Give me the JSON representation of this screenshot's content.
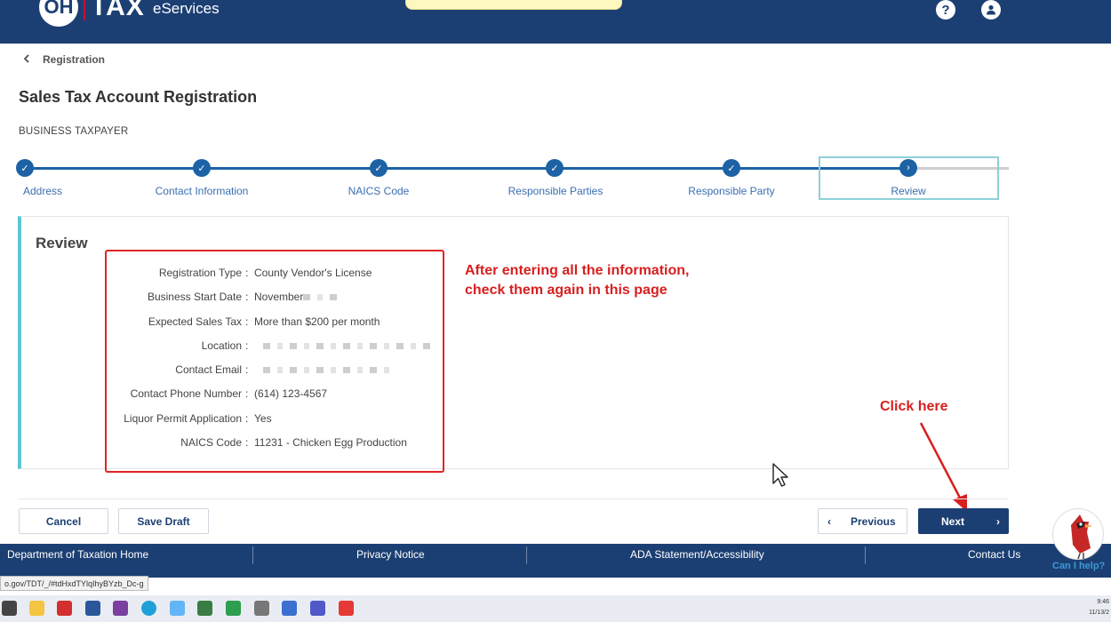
{
  "header": {
    "logo_oh": "OH",
    "logo_tax": "TAX",
    "logo_sub": "eServices",
    "help_icon": "?",
    "account_icon": "user-icon"
  },
  "breadcrumb": {
    "back_label": "Registration"
  },
  "page": {
    "title": "Sales Tax Account Registration",
    "subtitle": "BUSINESS TAXPAYER"
  },
  "stepper": {
    "steps": [
      {
        "label": "Address"
      },
      {
        "label": "Contact Information"
      },
      {
        "label": "NAICS Code"
      },
      {
        "label": "Responsible Parties"
      },
      {
        "label": "Responsible Party"
      },
      {
        "label": "Review"
      }
    ],
    "current": "Review"
  },
  "review": {
    "title": "Review",
    "rows": [
      {
        "label": "Registration Type",
        "value": "County Vendor's License"
      },
      {
        "label": "Business Start Date",
        "value": "November"
      },
      {
        "label": "Expected Sales Tax",
        "value": "More than $200 per month"
      },
      {
        "label": "Location",
        "value": ""
      },
      {
        "label": "Contact Email",
        "value": ""
      },
      {
        "label": "Contact Phone Number",
        "value": "(614) 123-4567"
      },
      {
        "label": "Liquor Permit Application",
        "value": "Yes"
      },
      {
        "label": "NAICS Code",
        "value": "11231 - Chicken Egg Production"
      }
    ],
    "separator": ":"
  },
  "annotations": {
    "note_line1": "After entering all the information,",
    "note_line2": "check them again in this page",
    "click_here": "Click here"
  },
  "actions": {
    "cancel": "Cancel",
    "save_draft": "Save Draft",
    "previous": "Previous",
    "next": "Next"
  },
  "footer": {
    "links": [
      "Department of Taxation Home",
      "Privacy Notice",
      "ADA Statement/Accessibility",
      "Contact Us"
    ]
  },
  "status_url": "o.gov/TDT/_/#tdHxdTYlqIhyBYzb_Dc-g",
  "chatbot": {
    "label": "Can I help?"
  },
  "clock": {
    "time": "9:46",
    "date": "11/13/2"
  },
  "colors": {
    "primary": "#1c3f73",
    "step_blue": "#1c62a5",
    "accent_teal": "#5fc6d4",
    "annotation_red": "#d81f1f"
  }
}
